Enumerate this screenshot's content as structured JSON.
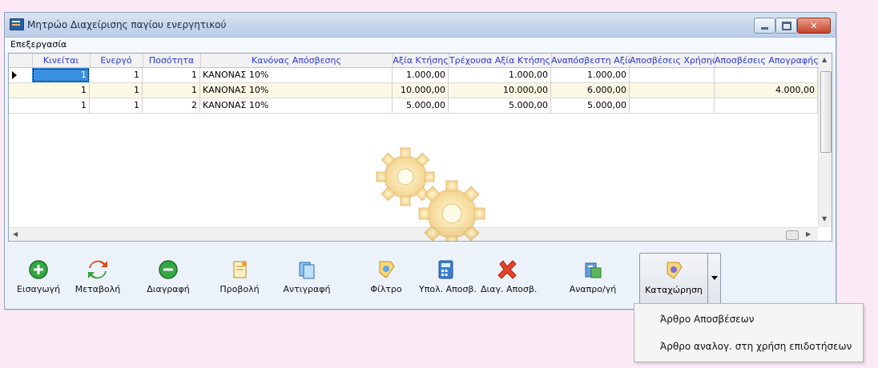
{
  "window": {
    "title": "Μητρώο Διαχείρισης παγίου ενεργητικού"
  },
  "menu": {
    "items": [
      "Επεξεργασία"
    ]
  },
  "grid": {
    "columns": [
      "Κινείται",
      "Ενεργό",
      "Ποσότητα",
      "Κανόνας Απόσβεσης",
      "Αξία Κτήσης",
      "Τρέχουσα Αξία Κτήσης",
      "Αναπόσβεστη Αξία",
      "Αποσβέσεις Χρήσης",
      "Αποσβέσεις Απογραφής"
    ],
    "rows": [
      [
        "1",
        "1",
        "1",
        "ΚΑΝΟΝΑΣ 10%",
        "1.000,00",
        "1.000,00",
        "1.000,00",
        "",
        ""
      ],
      [
        "1",
        "1",
        "1",
        "ΚΑΝΟΝΑΣ 10%",
        "10.000,00",
        "10.000,00",
        "6.000,00",
        "",
        "4.000,00"
      ],
      [
        "1",
        "1",
        "2",
        "ΚΑΝΟΝΑΣ 10%",
        "5.000,00",
        "5.000,00",
        "5.000,00",
        "",
        ""
      ]
    ]
  },
  "toolbar": {
    "buttons": [
      {
        "label": "Εισαγωγή",
        "icon": "plus-circle-icon"
      },
      {
        "label": "Μεταβολή",
        "icon": "refresh-icon"
      },
      {
        "label": "Διαγραφή",
        "icon": "minus-circle-icon"
      },
      {
        "label": "Προβολή",
        "icon": "view-icon"
      },
      {
        "label": "Αντιγραφή",
        "icon": "copy-icon"
      },
      {
        "label": "Φίλτρο",
        "icon": "filter-icon"
      },
      {
        "label": "Υπολ. Αποσβ.",
        "icon": "calculator-icon"
      },
      {
        "label": "Διαγ. Αποσβ.",
        "icon": "delete-x-icon"
      },
      {
        "label": "Αναπρο/γή",
        "icon": "revaluation-icon"
      }
    ],
    "split_button": {
      "label": "Καταχώρηση",
      "icon": "post-entry-icon"
    }
  },
  "dropdown": {
    "items": [
      "Άρθρο Αποσβέσεων",
      "Άρθρο αναλογ. στη χρήση επιδοτήσεων"
    ]
  },
  "colors": {
    "header_text": "#2a38d6",
    "selected_cell": "#3a8fe0",
    "alt_row": "#fbf8e4",
    "background": "#fce9f6"
  }
}
